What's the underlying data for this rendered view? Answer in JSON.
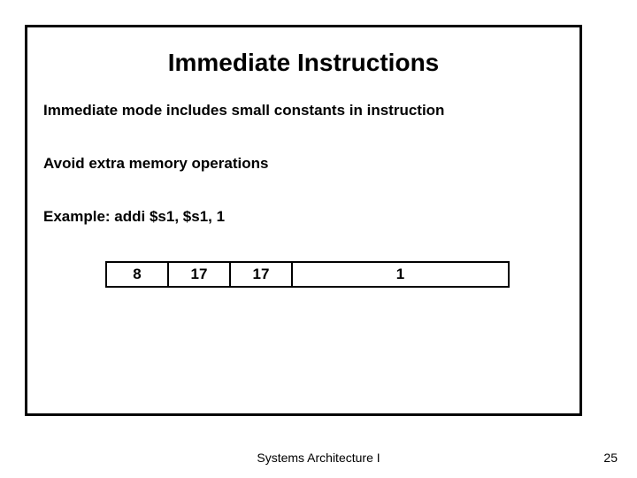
{
  "slide": {
    "title": "Immediate Instructions",
    "line1": "Immediate mode includes small constants in instruction",
    "line2": "Avoid extra memory operations",
    "example_label": "Example:  addi $s1, $s1, 1",
    "fields": {
      "opcode": "8",
      "rs": "17",
      "rt": "17",
      "imm": "1"
    }
  },
  "footer": {
    "course": "Systems Architecture I",
    "page": "25"
  }
}
